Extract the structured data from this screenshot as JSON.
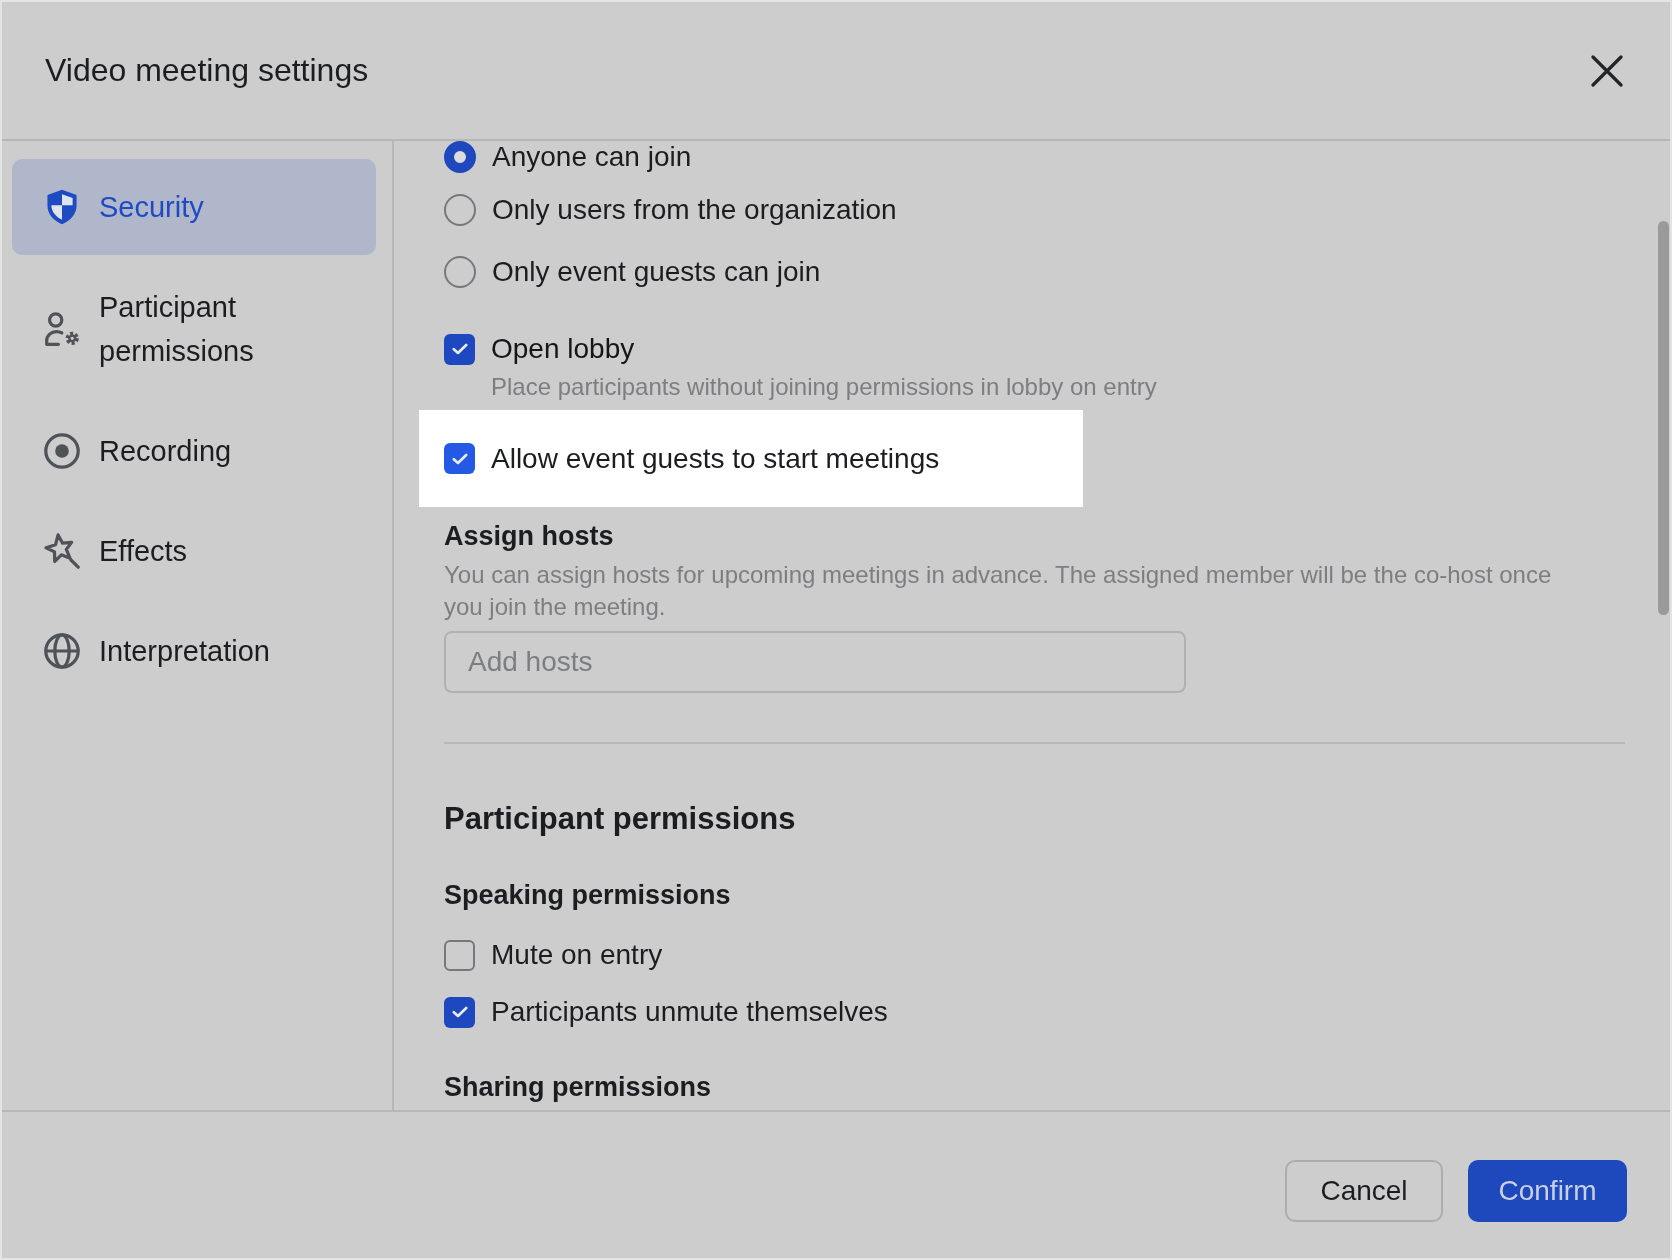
{
  "dialog": {
    "title": "Video meeting settings"
  },
  "sidebar": {
    "items": [
      {
        "label": "Security",
        "selected": true
      },
      {
        "label": "Participant permissions",
        "selected": false
      },
      {
        "label": "Recording",
        "selected": false
      },
      {
        "label": "Effects",
        "selected": false
      },
      {
        "label": "Interpretation",
        "selected": false
      }
    ]
  },
  "security": {
    "join_options": [
      {
        "label": "Anyone can join",
        "selected": true
      },
      {
        "label": "Only users from the organization",
        "selected": false
      },
      {
        "label": "Only event guests can join",
        "selected": false
      }
    ],
    "options": [
      {
        "label": "Open lobby",
        "checked": true,
        "highlighted": false,
        "description": "Place participants without joining permissions in lobby on entry"
      },
      {
        "label": "Allow event guests to start meetings",
        "checked": true,
        "highlighted": true
      }
    ],
    "assign_hosts": {
      "heading": "Assign hosts",
      "description": "You can assign hosts for upcoming meetings in advance. The assigned member will be the co-host once you join the meeting.",
      "placeholder": "Add hosts"
    }
  },
  "participant_permissions": {
    "heading": "Participant permissions",
    "speaking": {
      "heading": "Speaking permissions",
      "options": [
        {
          "label": "Mute on entry",
          "checked": false
        },
        {
          "label": "Participants unmute themselves",
          "checked": true
        }
      ]
    },
    "sharing": {
      "heading": "Sharing permissions"
    }
  },
  "buttons": [
    {
      "label": "Cancel",
      "kind": "secondary"
    },
    {
      "label": "Confirm",
      "kind": "primary"
    }
  ]
}
